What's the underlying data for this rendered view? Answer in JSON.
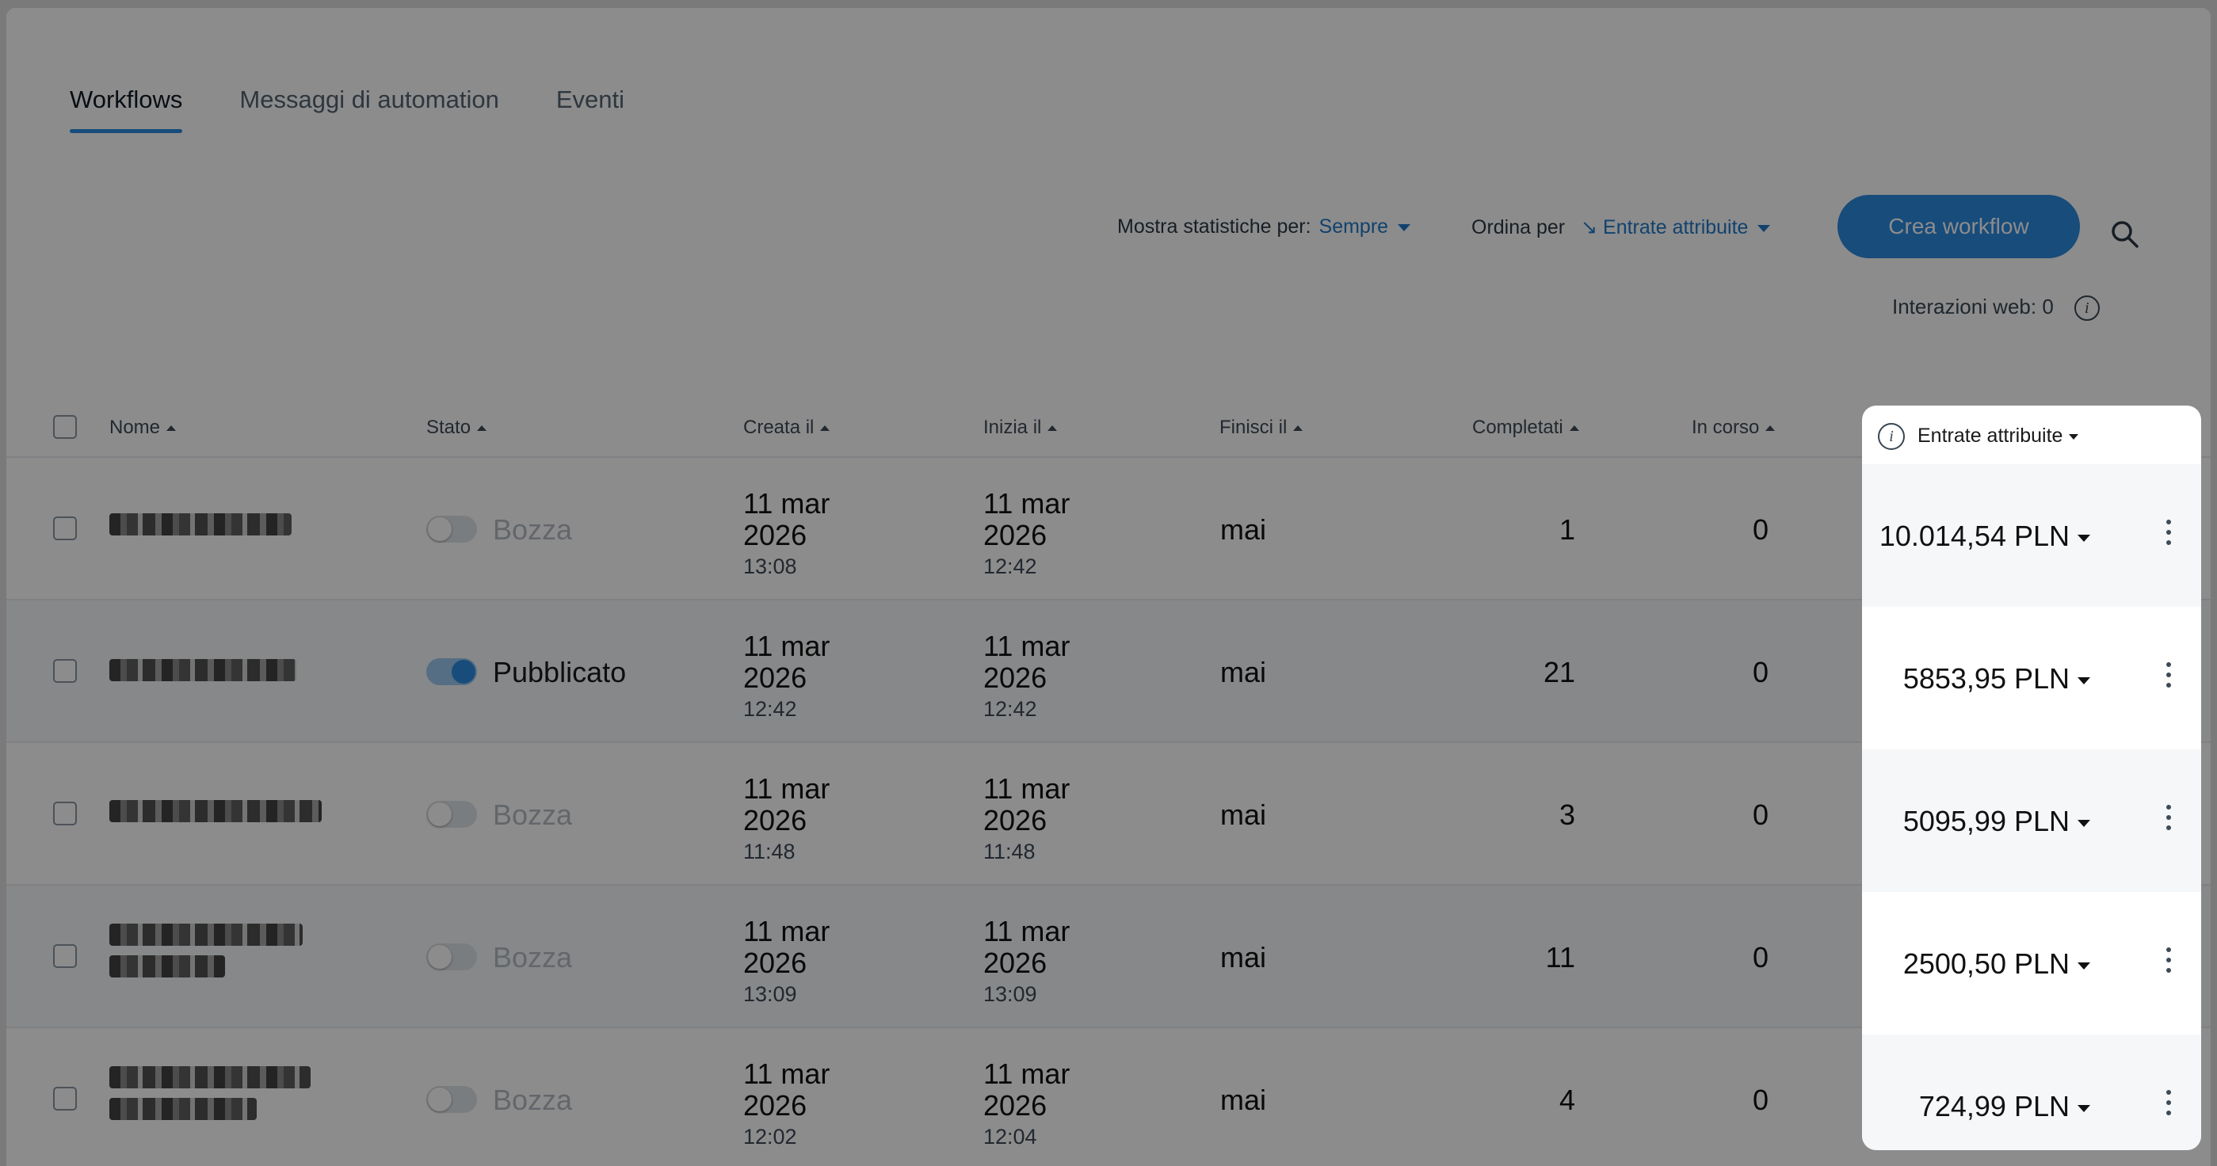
{
  "tabs": [
    "Workflows",
    "Messaggi di automation",
    "Eventi"
  ],
  "toolbar": {
    "stats_label": "Mostra statistiche per:",
    "stats_value": "Sempre",
    "sort_label": "Ordina per",
    "sort_value": "↘ Entrate attribuite",
    "create_button": "Crea workflow",
    "web_interactions": "Interazioni web: 0",
    "info_glyph": "i"
  },
  "columns": {
    "name": "Nome",
    "status": "Stato",
    "created": "Creata il",
    "starts": "Inizia il",
    "ends": "Finisci il",
    "completed": "Completati",
    "in_progress": "In corso",
    "revenue": "Entrate attribuite"
  },
  "rows": [
    {
      "name": "",
      "status": "Bozza",
      "published": false,
      "created_date": "11 mar 2026",
      "created_time": "13:08",
      "start_date": "11 mar 2026",
      "start_time": "12:42",
      "ends": "mai",
      "completed": "1",
      "in_progress": "0",
      "revenue": "10.014,54 PLN"
    },
    {
      "name": "",
      "status": "Pubblicato",
      "published": true,
      "created_date": "11 mar 2026",
      "created_time": "12:42",
      "start_date": "11 mar 2026",
      "start_time": "12:42",
      "ends": "mai",
      "completed": "21",
      "in_progress": "0",
      "revenue": "5853,95 PLN"
    },
    {
      "name": "",
      "status": "Bozza",
      "published": false,
      "created_date": "11 mar 2026",
      "created_time": "11:48",
      "start_date": "11 mar 2026",
      "start_time": "11:48",
      "ends": "mai",
      "completed": "3",
      "in_progress": "0",
      "revenue": "5095,99 PLN"
    },
    {
      "name": "",
      "status": "Bozza",
      "published": false,
      "created_date": "11 mar 2026",
      "created_time": "13:09",
      "start_date": "11 mar 2026",
      "start_time": "13:09",
      "ends": "mai",
      "completed": "11",
      "in_progress": "0",
      "revenue": "2500,50 PLN"
    },
    {
      "name": "",
      "status": "Bozza",
      "published": false,
      "created_date": "11 mar 2026",
      "created_time": "12:02",
      "start_date": "11 mar 2026",
      "start_time": "12:04",
      "ends": "mai",
      "completed": "4",
      "in_progress": "0",
      "revenue": "724,99 PLN"
    }
  ],
  "colors": {
    "accent": "#2b8be0",
    "link": "#1f78c8"
  },
  "icons": [
    "search-icon",
    "info-icon",
    "kebab-menu-icon",
    "caret-down-icon",
    "sort-up-icon"
  ]
}
